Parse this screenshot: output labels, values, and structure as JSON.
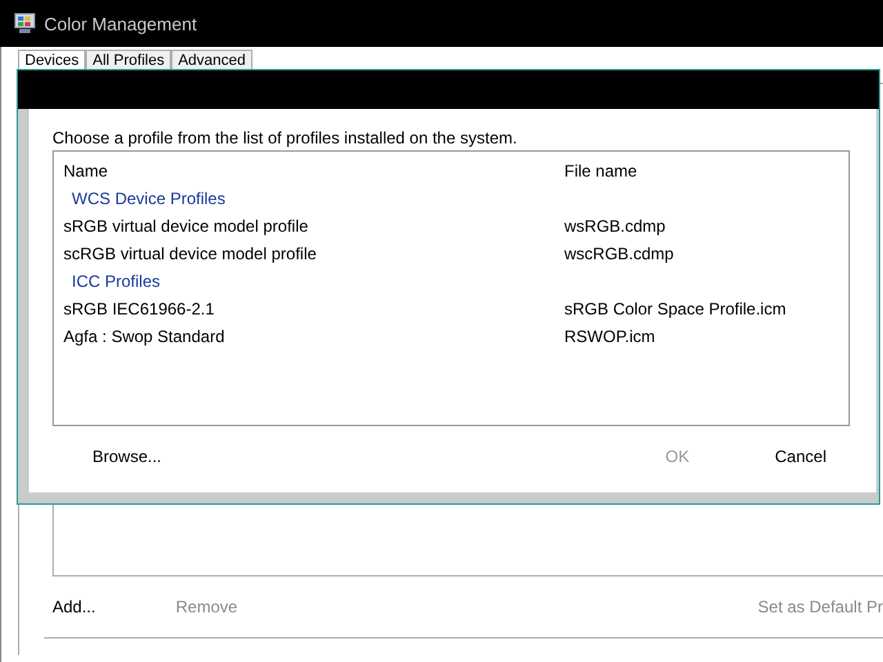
{
  "window": {
    "title": "Color Management"
  },
  "tabs": [
    {
      "label": "Devices",
      "selected": true
    },
    {
      "label": "All Profiles",
      "selected": false
    },
    {
      "label": "Advanced",
      "selected": false
    }
  ],
  "dialog": {
    "instruction": "Choose a profile from the list of profiles installed on the system.",
    "columns": [
      "Name",
      "File name"
    ],
    "groups": [
      {
        "name": "WCS Device Profiles",
        "profiles": [
          {
            "name": "sRGB virtual device model profile",
            "file": "wsRGB.cdmp"
          },
          {
            "name": "scRGB virtual device model profile",
            "file": "wscRGB.cdmp"
          }
        ]
      },
      {
        "name": "ICC Profiles",
        "profiles": [
          {
            "name": "sRGB IEC61966-2.1",
            "file": "sRGB Color Space Profile.icm"
          },
          {
            "name": "Agfa : Swop Standard",
            "file": "RSWOP.icm"
          }
        ]
      }
    ],
    "buttons": [
      {
        "label": "Browse...",
        "disabled": false
      },
      {
        "label": "OK",
        "disabled": true
      },
      {
        "label": "Cancel",
        "disabled": false
      }
    ]
  },
  "actions": [
    {
      "label": "Add...",
      "disabled": false
    },
    {
      "label": "Remove",
      "disabled": true
    },
    {
      "label": "Set as Default Pr",
      "disabled": true
    }
  ]
}
